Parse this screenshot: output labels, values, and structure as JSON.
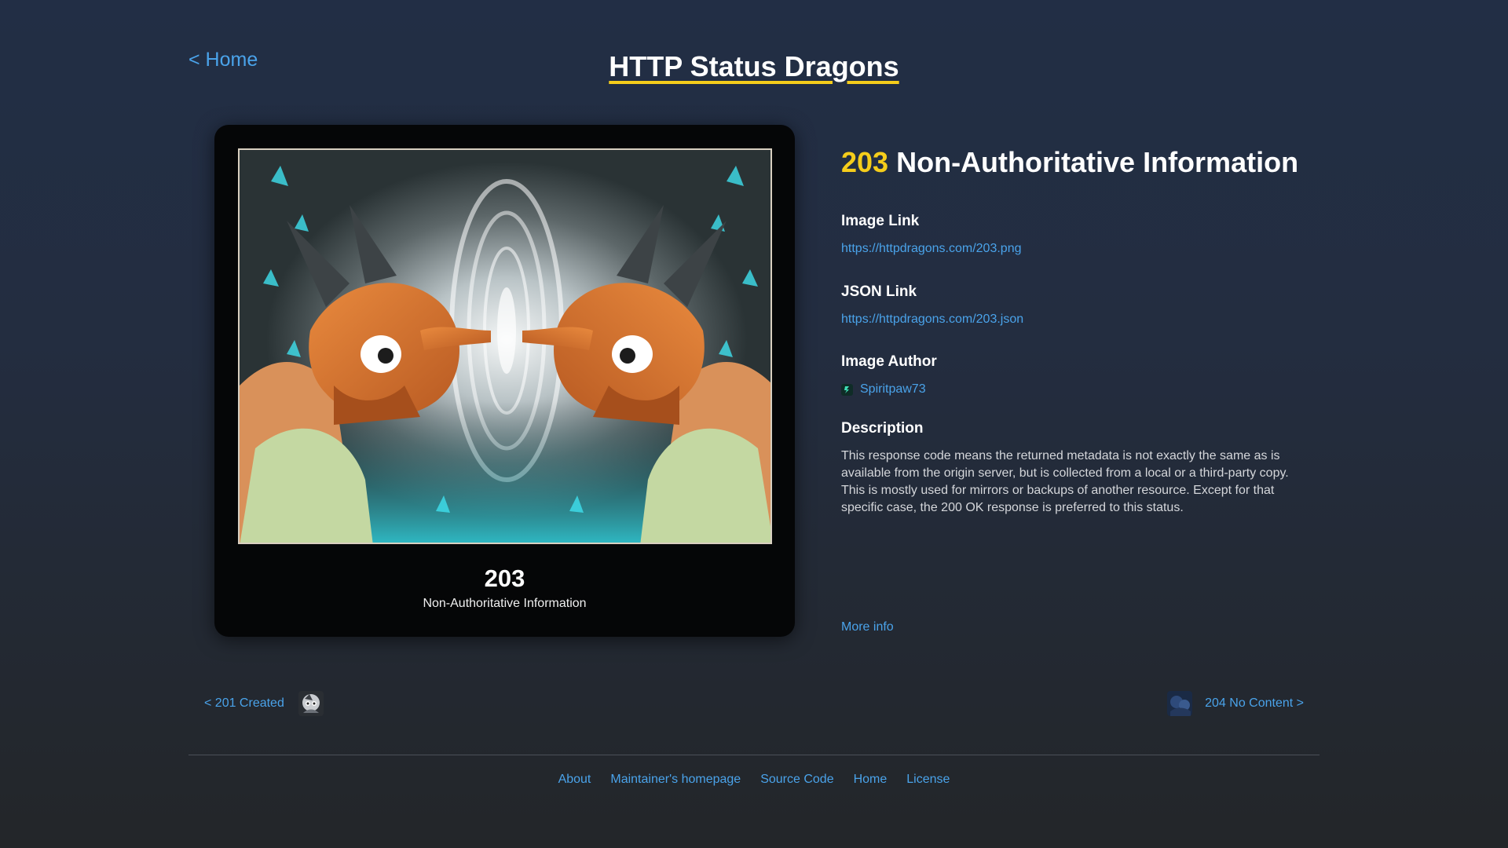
{
  "nav": {
    "home_label": "< Home"
  },
  "site_title": "HTTP Status Dragons",
  "card": {
    "code": "203",
    "label": "Non-Authoritative Information",
    "image_icon": "two-dragons-mirror-image"
  },
  "status": {
    "code": "203",
    "name": "Non-Authoritative Information"
  },
  "image_link": {
    "label": "Image Link",
    "url": "https://httpdragons.com/203.png"
  },
  "json_link": {
    "label": "JSON Link",
    "url": "https://httpdragons.com/203.json"
  },
  "author": {
    "label": "Image Author",
    "name": "Spiritpaw73",
    "avatar_icon": "author-avatar-icon"
  },
  "description": {
    "label": "Description",
    "text": "This response code means the returned metadata is not exactly the same as is available from the origin server, but is collected from a local or a third-party copy. This is mostly used for mirrors or backups of another resource. Except for that specific case, the 200 OK response is preferred to this status."
  },
  "more_info": "More info",
  "prev": {
    "label": "< 201 Created",
    "thumb_icon": "dragon-thumbnail-201"
  },
  "next": {
    "label": "204 No Content >",
    "thumb_icon": "dragon-thumbnail-204"
  },
  "footer": {
    "links": [
      "About",
      "Maintainer's homepage",
      "Source Code",
      "Home",
      "License"
    ]
  },
  "colors": {
    "accent_yellow": "#f5cd1b",
    "link_blue": "#4aa3ea",
    "card_bg": "#050607"
  }
}
